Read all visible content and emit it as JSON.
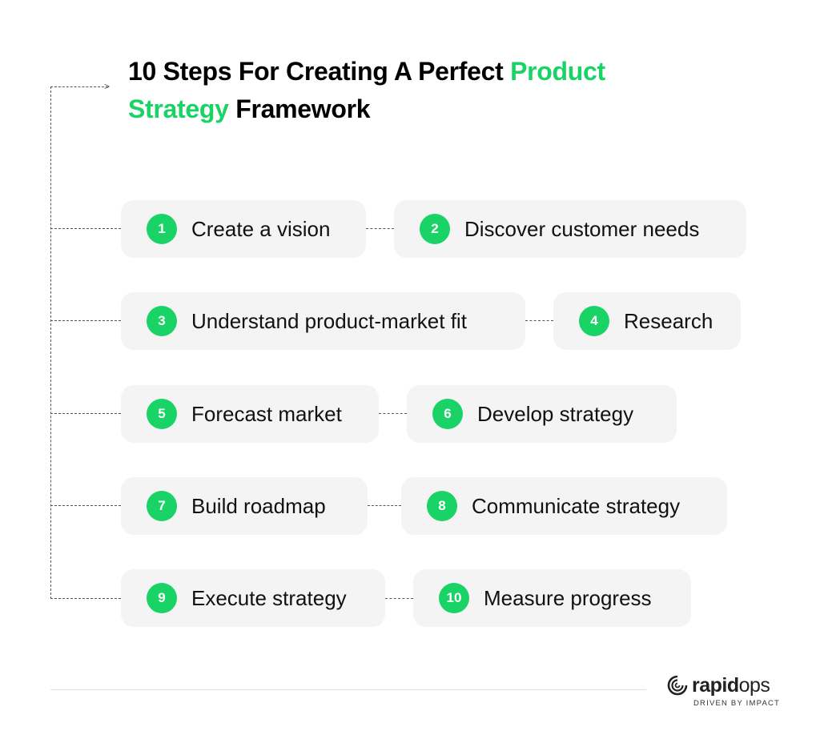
{
  "title": {
    "part1": "10 Steps For Creating A Perfect ",
    "highlight1": "Product",
    "highlight2": "Strategy",
    "part2": " Framework"
  },
  "colors": {
    "accent": "#19d366",
    "pill_bg": "#f4f4f4",
    "text": "#111111"
  },
  "steps": [
    {
      "number": "1",
      "label": "Create a vision"
    },
    {
      "number": "2",
      "label": "Discover customer needs"
    },
    {
      "number": "3",
      "label": "Understand product-market fit"
    },
    {
      "number": "4",
      "label": "Research"
    },
    {
      "number": "5",
      "label": "Forecast market"
    },
    {
      "number": "6",
      "label": "Develop strategy"
    },
    {
      "number": "7",
      "label": "Build roadmap"
    },
    {
      "number": "8",
      "label": "Communicate strategy"
    },
    {
      "number": "9",
      "label": "Execute strategy"
    },
    {
      "number": "10",
      "label": "Measure progress"
    }
  ],
  "logo": {
    "name_bold": "rapid",
    "name_light": "ops",
    "tagline": "DRIVEN BY IMPACT"
  }
}
